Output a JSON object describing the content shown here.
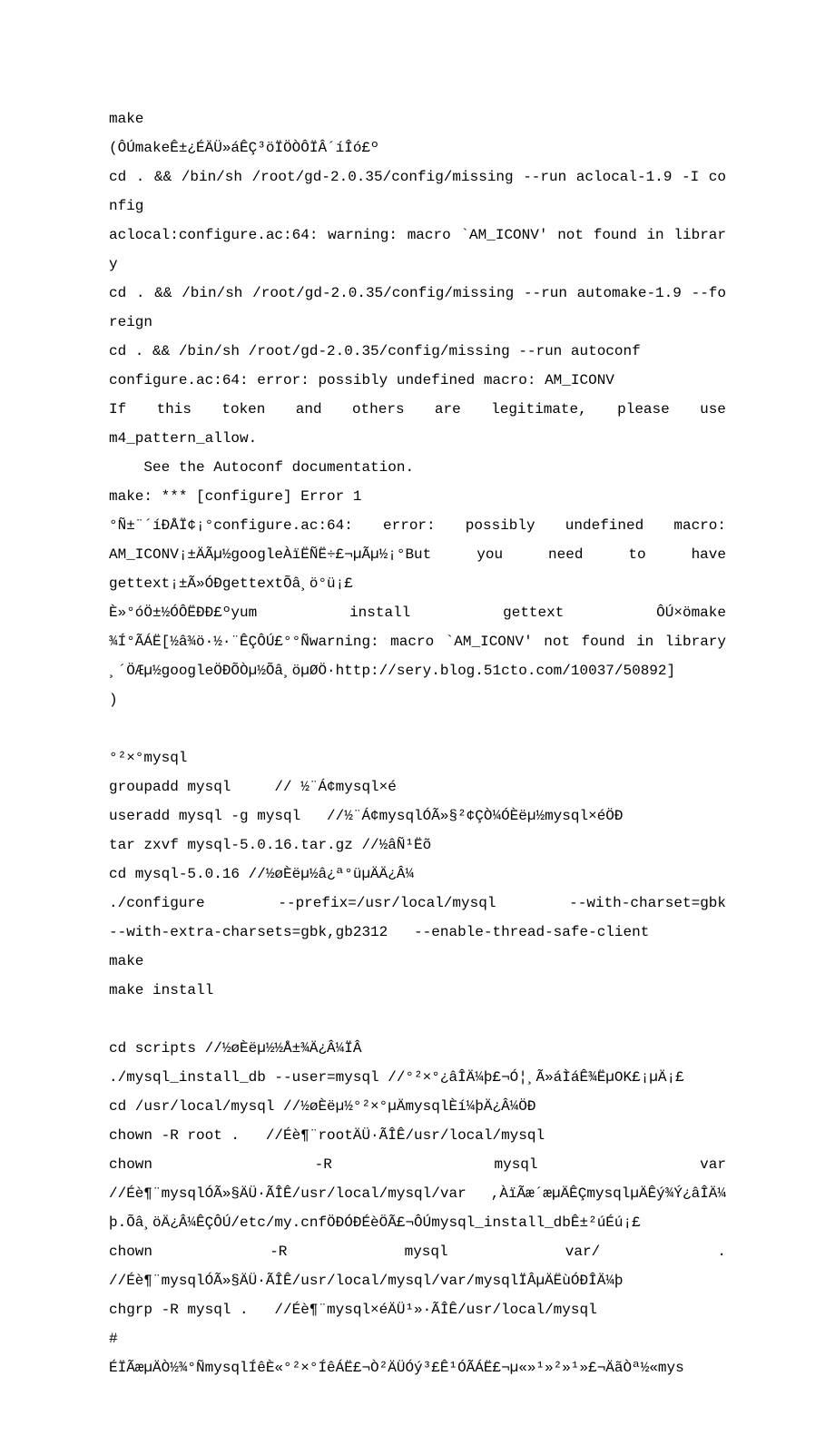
{
  "lines": [
    {
      "cls": "line",
      "txt": "make"
    },
    {
      "cls": "line",
      "txt": "(ÔÚmakeÊ±¿ÉÄÜ»áÊÇ³öÏÖÒÔÏÂ´íÎó£º"
    },
    {
      "cls": "line",
      "txt": "cd . && /bin/sh /root/gd-2.0.35/config/missing --run aclocal-1.9 -I config"
    },
    {
      "cls": "line",
      "txt": "aclocal:configure.ac:64: warning: macro `AM_ICONV' not found in library"
    },
    {
      "cls": "line",
      "txt": "cd . && /bin/sh /root/gd-2.0.35/config/missing --run automake-1.9 --foreign"
    },
    {
      "cls": "line",
      "txt": "cd . && /bin/sh /root/gd-2.0.35/config/missing --run autoconf"
    },
    {
      "cls": "line",
      "txt": "configure.ac:64: error: possibly undefined macro: AM_ICONV"
    },
    {
      "cls": "just",
      "parts": [
        "    If",
        "this",
        "token",
        "and",
        "others",
        "are",
        "legitimate,",
        "please",
        "use"
      ]
    },
    {
      "cls": "line",
      "txt": "m4_pattern_allow."
    },
    {
      "cls": "line indent",
      "txt": "See the Autoconf documentation."
    },
    {
      "cls": "line",
      "txt": "make: *** [configure] Error 1"
    },
    {
      "cls": "just",
      "parts": [
        "°Ñ±¨´íÐÅÏ¢¡°configure.ac:64:",
        "error:",
        "possibly",
        "undefined",
        "macro:"
      ]
    },
    {
      "cls": "just",
      "parts": [
        "AM_ICONV¡±ÄÃµ½googleÀïËÑË÷£¬µÃµ½¡°But",
        "you",
        "need",
        "to",
        "have"
      ]
    },
    {
      "cls": "line",
      "txt": "gettext¡±Ã»ÓÐgettextÕâ¸ö°ü¡£"
    },
    {
      "cls": "just",
      "parts": [
        "È»°óÖ±½ÓÔËÐÐ£ºyum",
        "install",
        "gettext",
        "ÔÚ×ömake"
      ]
    },
    {
      "cls": "line",
      "txt": "¾Í°ÃÁË[½â¾ö·½·¨ÊÇÔÚ£°°Ñwarning: macro `AM_ICONV' not found in library ¸´ÖÆµ½googleÖÐÕÒµ½Õâ¸öµØÖ·http://sery.blog.51cto.com/10037/50892]"
    },
    {
      "cls": "line",
      "txt": ")"
    },
    {
      "cls": "blank",
      "txt": ""
    },
    {
      "cls": "line",
      "txt": "°²×°mysql"
    },
    {
      "cls": "line",
      "txt": "groupadd mysql     // ½¨Á¢mysql×é"
    },
    {
      "cls": "line",
      "txt": "useradd mysql -g mysql   //½¨Á¢mysqlÓÃ»§²¢ÇÒ¼ÓÈëµ½mysql×éÖÐ"
    },
    {
      "cls": "line",
      "txt": "tar zxvf mysql-5.0.16.tar.gz //½âÑ¹Ëõ"
    },
    {
      "cls": "line",
      "txt": "cd mysql-5.0.16 //½øÈëµ½â¿ª°üµÄÄ¿Â¼"
    },
    {
      "cls": "just",
      "parts": [
        "./configure",
        "--prefix=/usr/local/mysql",
        "--with-charset=gbk"
      ]
    },
    {
      "cls": "line",
      "txt": "--with-extra-charsets=gbk,gb2312   --enable-thread-safe-client"
    },
    {
      "cls": "line",
      "txt": "make"
    },
    {
      "cls": "line",
      "txt": "make install"
    },
    {
      "cls": "blank",
      "txt": ""
    },
    {
      "cls": "line",
      "txt": "cd scripts //½øÈëµ½½Å±¾Ä¿Â¼ÏÂ"
    },
    {
      "cls": "line",
      "txt": "./mysql_install_db --user=mysql //°²×°¿âÎÄ¼þ£¬Ó¦¸Ã»áÌáÊ¾ËµOK£¡µÄ¡£"
    },
    {
      "cls": "line",
      "txt": "cd /usr/local/mysql //½øÈëµ½°²×°µÄmysqlÈí¼þÄ¿Â¼ÖÐ"
    },
    {
      "cls": "line",
      "txt": "chown -R root .   //Éè¶¨rootÄÜ·ÃÎÊ/usr/local/mysql"
    },
    {
      "cls": "just",
      "parts": [
        "chown",
        "-R",
        "mysql",
        "var"
      ]
    },
    {
      "cls": "line",
      "txt": "//Éè¶¨mysqlÓÃ»§ÄÜ·ÃÎÊ/usr/local/mysql/var ,ÀïÃæ´æµÄÊÇmysqlµÄÊý¾Ý¿âÎÄ¼þ.Õâ¸öÄ¿Â¼ÊÇÔÚ/etc/my.cnfÖÐÓÐÉèÖÃ£¬ÔÚmysql_install_dbÊ±²úÉú¡£"
    },
    {
      "cls": "just",
      "parts": [
        "chown",
        "-R",
        "mysql",
        "var/",
        "."
      ]
    },
    {
      "cls": "line",
      "txt": "//Éè¶¨mysqlÓÃ»§ÄÜ·ÃÎÊ/usr/local/mysql/var/mysqlÏÂµÄËùÓÐÎÄ¼þ"
    },
    {
      "cls": "line",
      "txt": "chgrp -R mysql .   //Éè¶¨mysql×éÄÜ¹»·ÃÎÊ/usr/local/mysql"
    },
    {
      "cls": "line",
      "txt": "#"
    },
    {
      "cls": "line",
      "txt": "ÉÏÃæµÄÒ½¾­°ÑmysqlÍêÈ«°²×°ÍêÁË£¬Ò²ÄÜÓý³£Ê¹ÓÃÁË£¬µ«»¹»²»¹»£¬ÄãÒª½«mys"
    }
  ]
}
